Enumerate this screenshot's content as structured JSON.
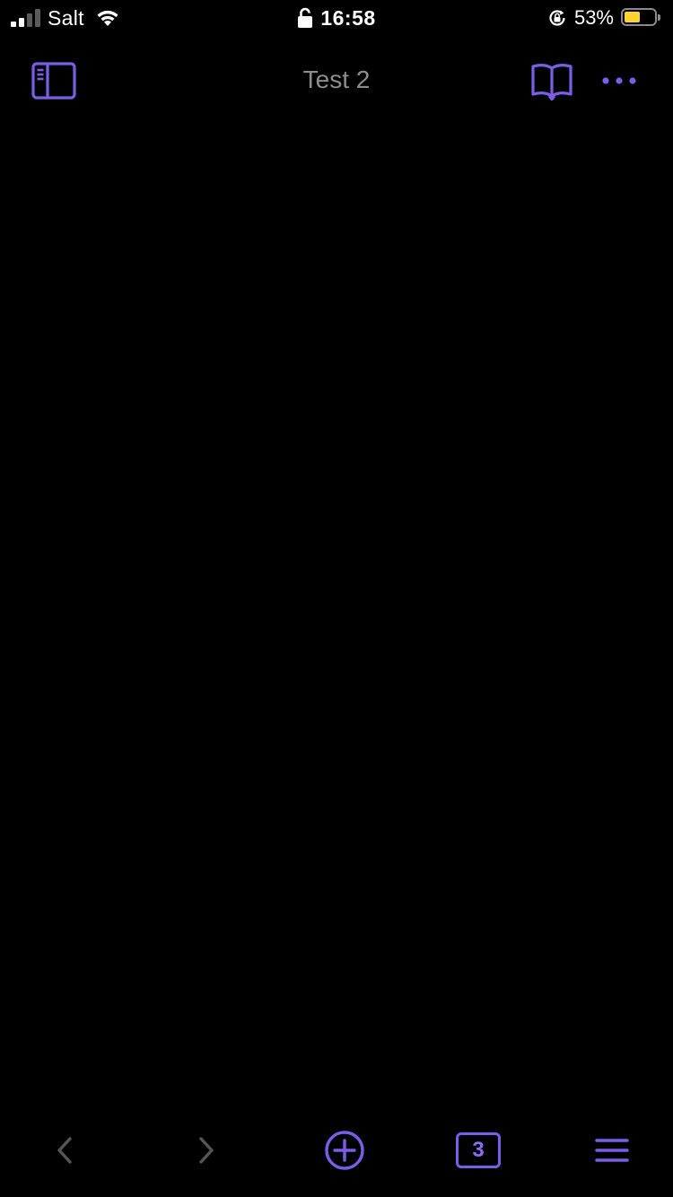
{
  "status_bar": {
    "carrier": "Salt",
    "time": "16:58",
    "battery_percent_label": "53%",
    "battery_level": 0.53
  },
  "nav": {
    "title": "Test 2",
    "sidebar_icon": "sidebar-icon",
    "reader_icon": "open-book-icon",
    "more_icon": "ellipsis-icon"
  },
  "toolbar": {
    "back_icon": "chevron-left-icon",
    "forward_icon": "chevron-right-icon",
    "new_icon": "plus-circle-icon",
    "tabs_count": "3",
    "menu_icon": "hamburger-icon"
  },
  "colors": {
    "accent": "#7b5de6",
    "disabled": "#555555",
    "title": "#8d8d8d",
    "background": "#000000",
    "battery": "#ffd32e"
  }
}
